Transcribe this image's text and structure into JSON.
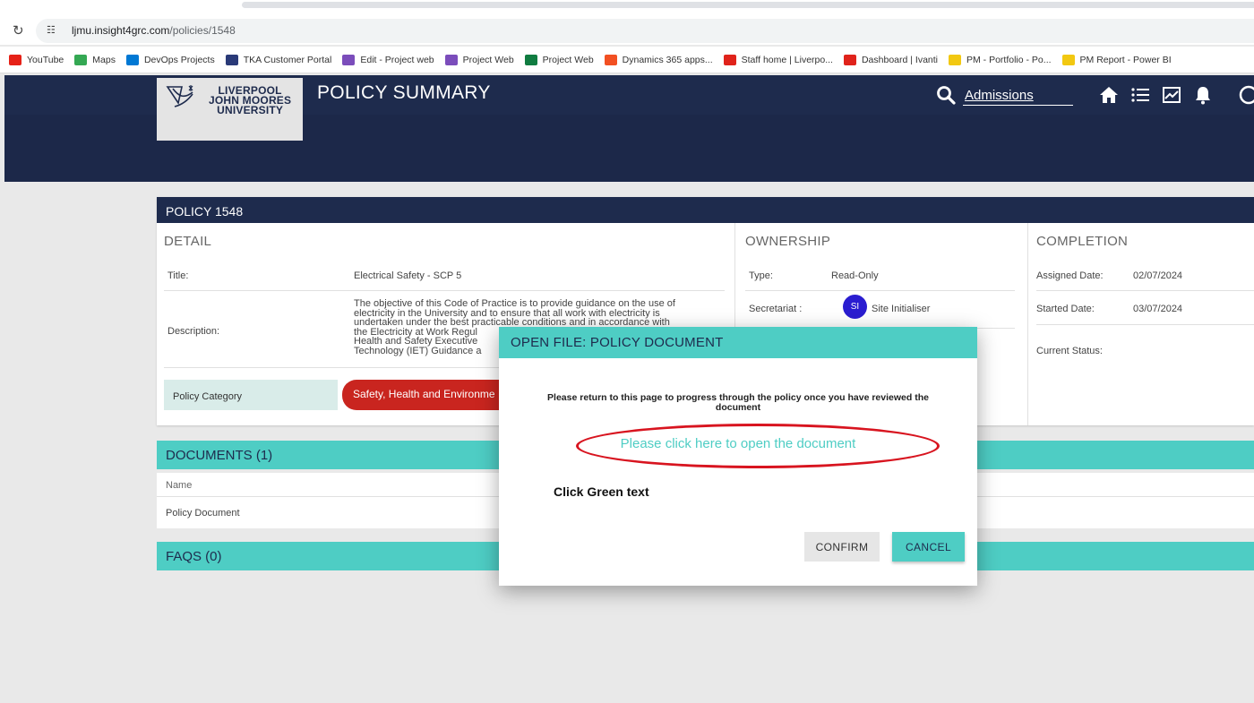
{
  "browser": {
    "url_host": "ljmu.insight4grc.com",
    "url_path": "/policies/1548",
    "bookmarks": [
      {
        "label": "YouTube",
        "color": "#e62117"
      },
      {
        "label": "Maps",
        "color": "#34a853"
      },
      {
        "label": "DevOps Projects",
        "color": "#0078d4"
      },
      {
        "label": "TKA Customer Portal",
        "color": "#2a3a78"
      },
      {
        "label": "Edit - Project web",
        "color": "#7b4dbb"
      },
      {
        "label": "Project Web",
        "color": "#7b4dbb"
      },
      {
        "label": "Project Web",
        "color": "#107c41"
      },
      {
        "label": "Dynamics 365 apps...",
        "color": "#f25022"
      },
      {
        "label": "Staff home | Liverpo...",
        "color": "#e0231b"
      },
      {
        "label": "Dashboard | Ivanti",
        "color": "#e0231b"
      },
      {
        "label": "PM - Portfolio - Po...",
        "color": "#f2c811"
      },
      {
        "label": "PM Report - Power BI",
        "color": "#f2c811"
      }
    ]
  },
  "header": {
    "logo_lines": [
      "LIVERPOOL",
      "JOHN MOORES",
      "UNIVERSITY"
    ],
    "title": "POLICY SUMMARY",
    "search_value": "Admissions"
  },
  "policy": {
    "heading": "POLICY 1548",
    "detail_title": "DETAIL",
    "title_label": "Title:",
    "title_value": "Electrical Safety - SCP 5",
    "description_label": "Description:",
    "description_lines": [
      "The objective of this Code of Practice is to provide guidance on the use of",
      "electricity in the University and to ensure that all work with electricity is",
      "undertaken under the best practicable conditions and in accordance with",
      "the Electricity at Work Regul",
      "Health and Safety Executive",
      "Technology (IET) Guidance a"
    ],
    "category_label": "Policy Category",
    "category_value": "Safety, Health and Environme",
    "ownership_title": "OWNERSHIP",
    "type_label": "Type:",
    "type_value": "Read-Only",
    "secretariat_label": "Secretariat :",
    "secretariat_initials": "SI",
    "secretariat_value": "Site Initialiser",
    "completion_title": "COMPLETION",
    "assigned_label": "Assigned Date:",
    "assigned_value": "02/07/2024",
    "started_label": "Started Date:",
    "started_value": "03/07/2024",
    "status_label": "Current Status:"
  },
  "documents": {
    "heading": "DOCUMENTS (1)",
    "col_name": "Name",
    "rows": [
      "Policy Document"
    ]
  },
  "faqs": {
    "heading": "FAQS (0)"
  },
  "modal": {
    "title": "OPEN FILE: POLICY DOCUMENT",
    "message_line1": "Please return to this page to progress through the policy once you have reviewed the",
    "message_line2": "document",
    "link_text": "Please click here to open the document",
    "annotation": "Click Green text",
    "confirm": "CONFIRM",
    "cancel": "CANCEL"
  },
  "colors": {
    "navy": "#1e2b4d",
    "teal": "#4ecdc4",
    "category_red": "#c9251f",
    "annotation_red": "#d8141f"
  }
}
